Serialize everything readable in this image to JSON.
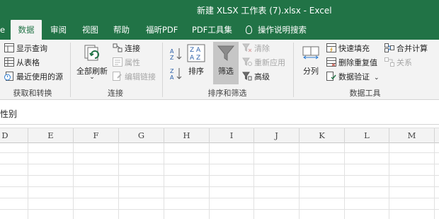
{
  "window": {
    "title": "新建 XLSX 工作表 (7).xlsx  -  Excel",
    "accent_color": "#217346"
  },
  "tabs": [
    {
      "label": "e",
      "active": false
    },
    {
      "label": "数据",
      "active": true
    },
    {
      "label": "审阅",
      "active": false
    },
    {
      "label": "视图",
      "active": false
    },
    {
      "label": "帮助",
      "active": false
    },
    {
      "label": "福昕PDF",
      "active": false
    },
    {
      "label": "PDF工具集",
      "active": false
    },
    {
      "label": "操作说明搜索",
      "active": false,
      "icon": "lightbulb-icon"
    }
  ],
  "ribbon": {
    "get_transform": {
      "label": "获取和转换",
      "items": [
        "显示查询",
        "从表格",
        "最近使用的源"
      ]
    },
    "connections": {
      "label": "连接",
      "refresh_all": "全部刷新",
      "items": [
        {
          "label": "连接",
          "enabled": true
        },
        {
          "label": "属性",
          "enabled": false
        },
        {
          "label": "编辑链接",
          "enabled": false
        }
      ]
    },
    "sort_filter": {
      "label": "排序和筛选",
      "sort": "排序",
      "filter": "筛选",
      "items": [
        {
          "label": "清除",
          "enabled": false
        },
        {
          "label": "重新应用",
          "enabled": false
        },
        {
          "label": "高级",
          "enabled": true
        }
      ]
    },
    "data_tools": {
      "label": "数据工具",
      "split": "分列",
      "items": [
        {
          "label": "快速填充",
          "enabled": true
        },
        {
          "label": "删除重复值",
          "enabled": true
        },
        {
          "label": "数据验证",
          "enabled": true
        }
      ],
      "items2": [
        {
          "label": "合并计算",
          "enabled": true
        },
        {
          "label": "关系",
          "enabled": false
        }
      ]
    }
  },
  "formula_bar": {
    "value": "性别"
  },
  "columns": [
    "D",
    "E",
    "F",
    "G",
    "H",
    "I",
    "J",
    "K",
    "L",
    "M"
  ]
}
